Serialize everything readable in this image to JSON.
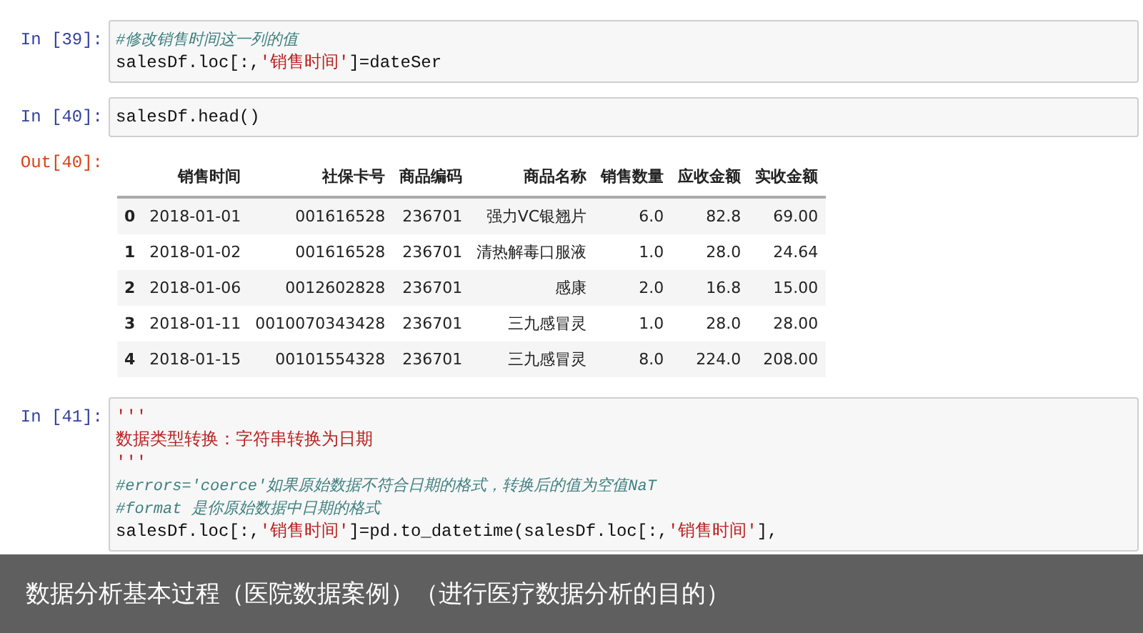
{
  "cells": [
    {
      "prompt": "In  [39]:",
      "lines": [
        [
          {
            "kind": "comment",
            "text": "#修改销售时间这一列的值"
          }
        ],
        [
          {
            "kind": "plain",
            "text": "salesDf.loc[:,"
          },
          {
            "kind": "string",
            "text": "'销售时间'"
          },
          {
            "kind": "plain",
            "text": "]=dateSer"
          }
        ]
      ]
    },
    {
      "prompt": "In  [40]:",
      "lines": [
        [
          {
            "kind": "plain",
            "text": "salesDf.head()"
          }
        ]
      ],
      "output": {
        "prompt": "Out[40]:",
        "table": {
          "columns": [
            "",
            "销售时间",
            "社保卡号",
            "商品编码",
            "商品名称",
            "销售数量",
            "应收金额",
            "实收金额"
          ],
          "rows": [
            [
              "0",
              "2018-01-01",
              "001616528",
              "236701",
              "强力VC银翘片",
              "6.0",
              "82.8",
              "69.00"
            ],
            [
              "1",
              "2018-01-02",
              "001616528",
              "236701",
              "清热解毒口服液",
              "1.0",
              "28.0",
              "24.64"
            ],
            [
              "2",
              "2018-01-06",
              "0012602828",
              "236701",
              "感康",
              "2.0",
              "16.8",
              "15.00"
            ],
            [
              "3",
              "2018-01-11",
              "0010070343428",
              "236701",
              "三九感冒灵",
              "1.0",
              "28.0",
              "28.00"
            ],
            [
              "4",
              "2018-01-15",
              "00101554328",
              "236701",
              "三九感冒灵",
              "8.0",
              "224.0",
              "208.00"
            ]
          ]
        }
      }
    },
    {
      "prompt": "In  [41]:",
      "lines": [
        [
          {
            "kind": "string",
            "text": "'''"
          }
        ],
        [
          {
            "kind": "string",
            "text": "数据类型转换：字符串转换为日期"
          }
        ],
        [
          {
            "kind": "string",
            "text": "'''"
          }
        ],
        [
          {
            "kind": "comment",
            "text": "#errors='coerce'如果原始数据不符合日期的格式，转换后的值为空值NaT"
          }
        ],
        [
          {
            "kind": "comment",
            "text": "#format 是你原始数据中日期的格式"
          }
        ],
        [
          {
            "kind": "plain",
            "text": "salesDf.loc[:,"
          },
          {
            "kind": "string",
            "text": "'销售时间'"
          },
          {
            "kind": "plain",
            "text": "]=pd.to_datetime(salesDf.loc[:,"
          },
          {
            "kind": "string",
            "text": "'销售时间'"
          },
          {
            "kind": "plain",
            "text": "],"
          }
        ]
      ]
    }
  ],
  "caption": "数据分析基本过程（医院数据案例）（进行医疗数据分析的目的）"
}
